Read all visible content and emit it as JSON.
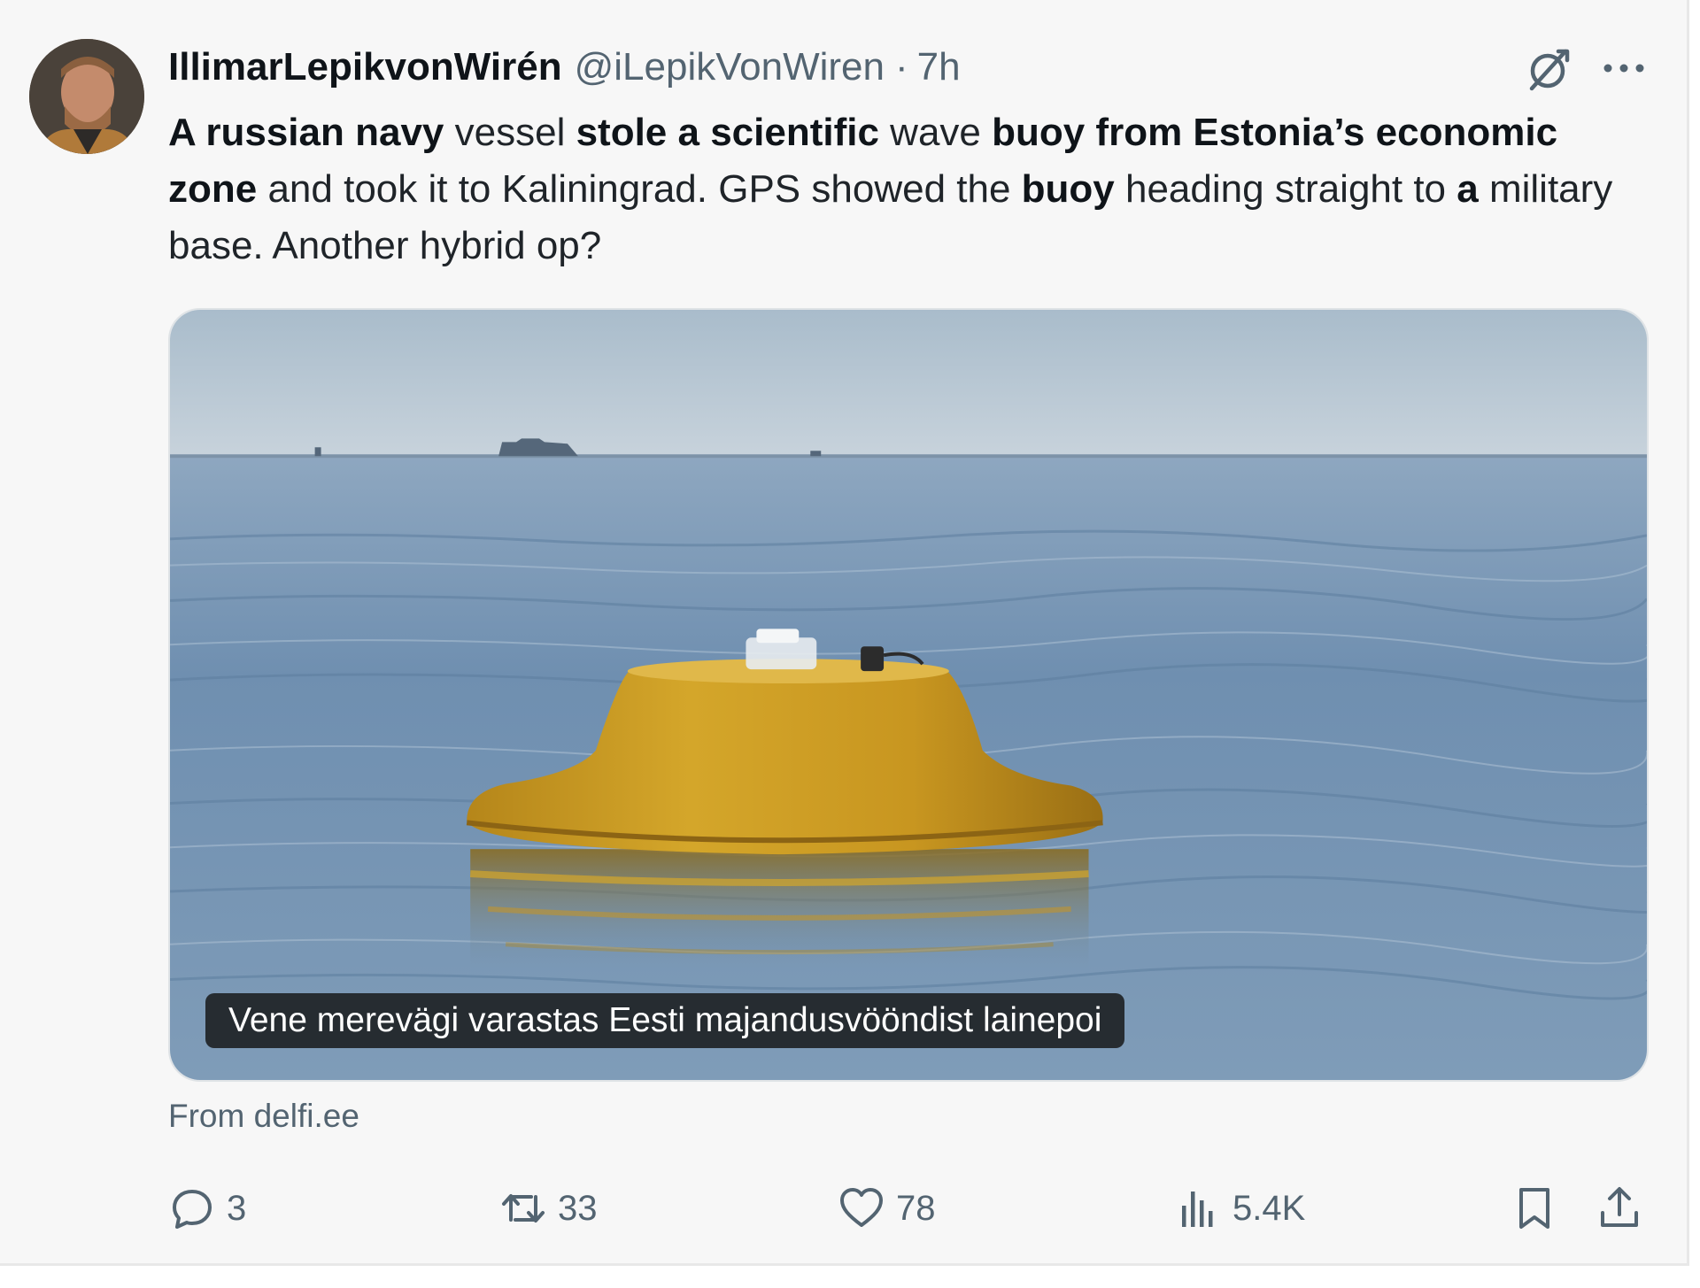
{
  "tweet": {
    "author": {
      "display_name": "IllimarLepikvonWirén",
      "handle": "@iLepikVonWiren",
      "separator": "·",
      "time": "7h"
    },
    "text_segments": [
      {
        "text": "A russian navy",
        "bold": true
      },
      {
        "text": " vessel ",
        "bold": false
      },
      {
        "text": "stole a scientific",
        "bold": true
      },
      {
        "text": " wave ",
        "bold": false
      },
      {
        "text": "buoy from Estonia’s economic zone",
        "bold": true
      },
      {
        "text": " and took it to Kaliningrad. GPS showed the ",
        "bold": false
      },
      {
        "text": "buoy",
        "bold": true
      },
      {
        "text": " heading straight to ",
        "bold": false
      },
      {
        "text": "a",
        "bold": true
      },
      {
        "text": " military base. Another hybrid op?",
        "bold": false
      }
    ],
    "media": {
      "caption": "Vene merevägi varastas Eesti majandusvööndist lainepoi"
    },
    "source": "From delfi.ee",
    "actions": {
      "replies": "3",
      "reposts": "33",
      "likes": "78",
      "views": "5.4K"
    }
  },
  "icons": {
    "grok": "grok-icon",
    "more": "more-icon",
    "reply": "reply-icon",
    "repost": "repost-icon",
    "like": "heart-icon",
    "views": "views-chart-icon",
    "bookmark": "bookmark-icon",
    "share": "share-icon"
  },
  "colors": {
    "text_primary": "#0f1419",
    "text_secondary": "#536471",
    "card_background": "#f7f7f7",
    "buoy": "#c99a1e"
  }
}
